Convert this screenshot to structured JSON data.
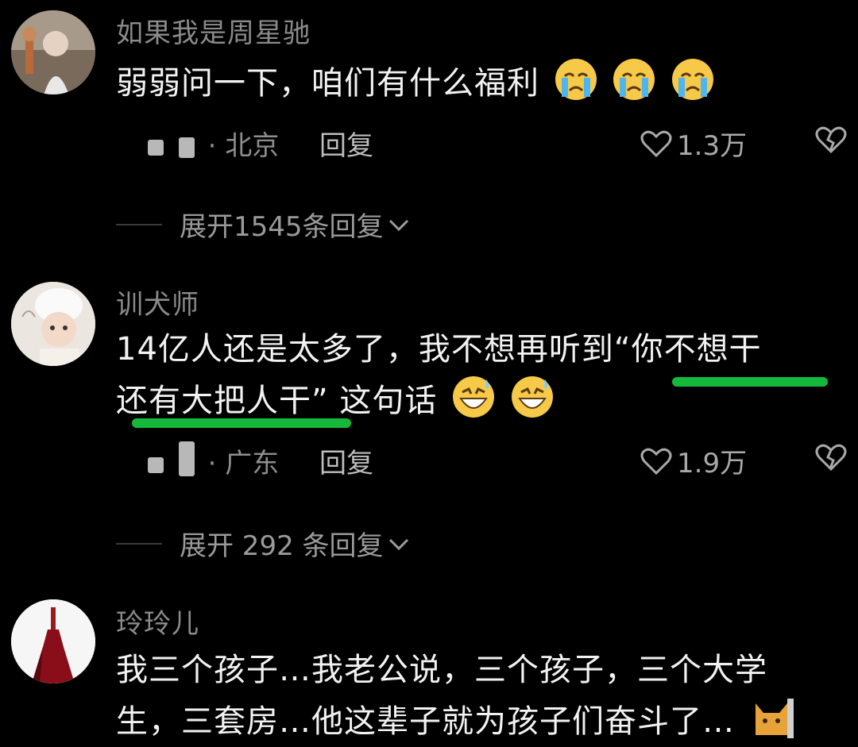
{
  "comments": [
    {
      "username": "如果我是周星驰",
      "lines": [
        "弱弱问一下，咱们有什么福利"
      ],
      "emoji": "crying-face-icon",
      "location": "· 北京",
      "reply": "回复",
      "likes": "1.3万",
      "expand": "展开1545条回复"
    },
    {
      "username": "训犬师",
      "lines": [
        "14亿人还是太多了，我不想再听到“你不想干",
        "还有大把人干” 这句话"
      ],
      "emoji": "grinning-sweat-face-icon",
      "location": "· 广东",
      "reply": "回复",
      "likes": "1.9万",
      "expand": "展开 292 条回复"
    },
    {
      "username": "玲玲儿",
      "lines": [
        "我三个孩子…我老公说，三个孩子，三个大学",
        "生，三套房…他这辈子就为孩子们奋斗了…"
      ],
      "emoji": "cat-face-icon"
    }
  ],
  "colors": {
    "highlight": "#16b83b",
    "background": "#000000"
  }
}
